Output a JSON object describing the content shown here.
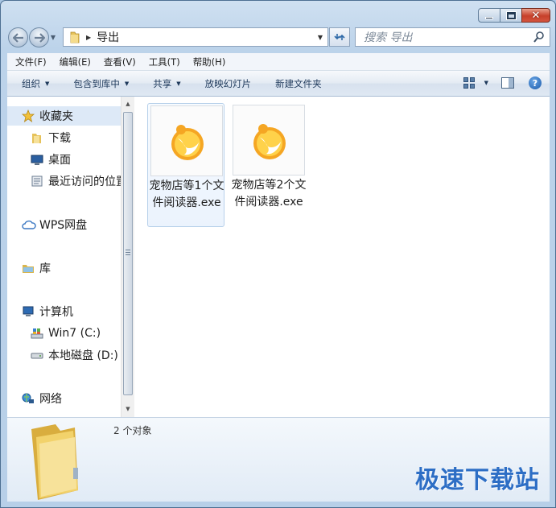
{
  "window": {
    "caption": {
      "minimize_icon": "minimize-icon",
      "maximize_icon": "maximize-icon",
      "close_glyph": "✕"
    }
  },
  "nav": {
    "back_icon": "back-arrow-icon",
    "forward_icon": "forward-arrow-icon",
    "address": {
      "crumb": "导出"
    },
    "search": {
      "placeholder": "搜索 导出"
    }
  },
  "menubar": {
    "items": [
      {
        "label": "文件(F)"
      },
      {
        "label": "编辑(E)"
      },
      {
        "label": "查看(V)"
      },
      {
        "label": "工具(T)"
      },
      {
        "label": "帮助(H)"
      }
    ]
  },
  "commandbar": {
    "organize": "组织",
    "include_in_library": "包含到库中",
    "share": "共享",
    "slideshow": "放映幻灯片",
    "new_folder": "新建文件夹",
    "help_glyph": "?"
  },
  "navpane": {
    "favorites": "收藏夹",
    "downloads": "下载",
    "desktop": "桌面",
    "recent": "最近访问的位置",
    "wps": "WPS网盘",
    "libraries": "库",
    "computer": "计算机",
    "drive_c": "Win7 (C:)",
    "drive_d": "本地磁盘 (D:)",
    "network": "网络"
  },
  "files": [
    {
      "name": "宠物店等1个文件阅读器.exe",
      "selected": true
    },
    {
      "name": "宠物店等2个文件阅读器.exe",
      "selected": false
    }
  ],
  "details": {
    "count": "2 个对象"
  },
  "watermark": "极速下载站",
  "colors": {
    "accent": "#2d6ec5",
    "app_icon_orange": "#f5a623",
    "folder_yellow": "#f2d26b"
  }
}
